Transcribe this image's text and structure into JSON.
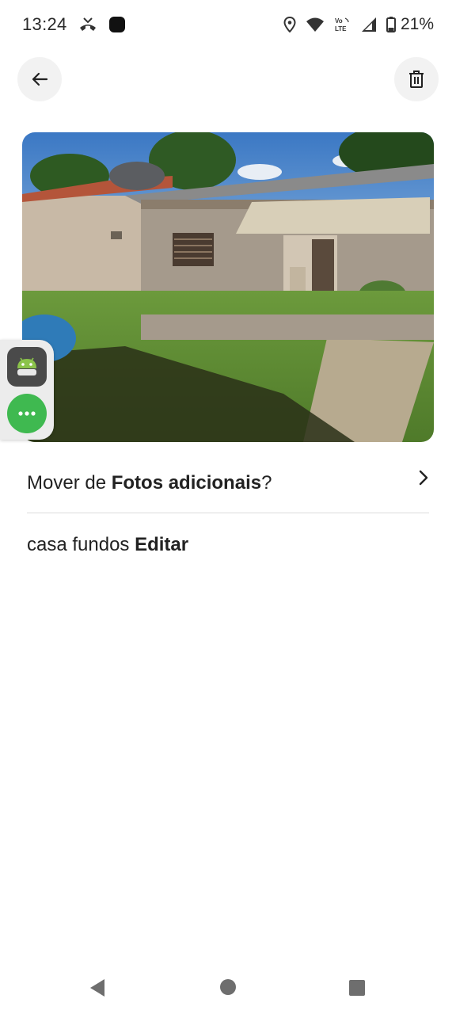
{
  "status_bar": {
    "time": "13:24",
    "battery": "21%",
    "icons": [
      "missed-call-icon",
      "app-notification-icon",
      "location-icon",
      "wifi-icon",
      "volte-icon",
      "signal-icon",
      "battery-icon"
    ]
  },
  "header": {
    "back_icon": "arrow-left-icon",
    "delete_icon": "trash-icon"
  },
  "photo": {
    "alt": "house photo"
  },
  "move_row": {
    "prefix": "Mover de ",
    "album": "Fotos adicionais",
    "suffix": "?"
  },
  "caption_row": {
    "caption": "casa fundos",
    "edit_label": "Editar"
  },
  "side_widget": {
    "assistant_icon": "android-assistant-icon",
    "more_icon": "more-dots-icon"
  },
  "nav_bar": {
    "icons": [
      "nav-back-icon",
      "nav-home-icon",
      "nav-recents-icon"
    ]
  },
  "colors": {
    "accent_green": "#3fb950",
    "button_bg": "#f2f2f2",
    "text": "#222222"
  }
}
